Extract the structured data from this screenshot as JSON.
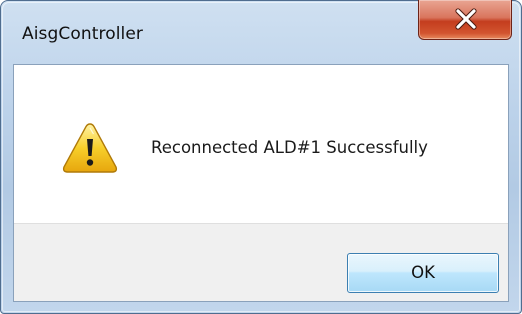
{
  "window": {
    "title": "AisgController",
    "close_icon": "close-icon"
  },
  "dialog": {
    "icon": "warning-icon",
    "message": "Reconnected ALD#1 Successfully",
    "ok_label": "OK"
  },
  "colors": {
    "close_button": "#c43d1e",
    "ok_border": "#3c7fb1",
    "warning_yellow": "#f5c518",
    "footer_background": "#f0f0f0"
  }
}
